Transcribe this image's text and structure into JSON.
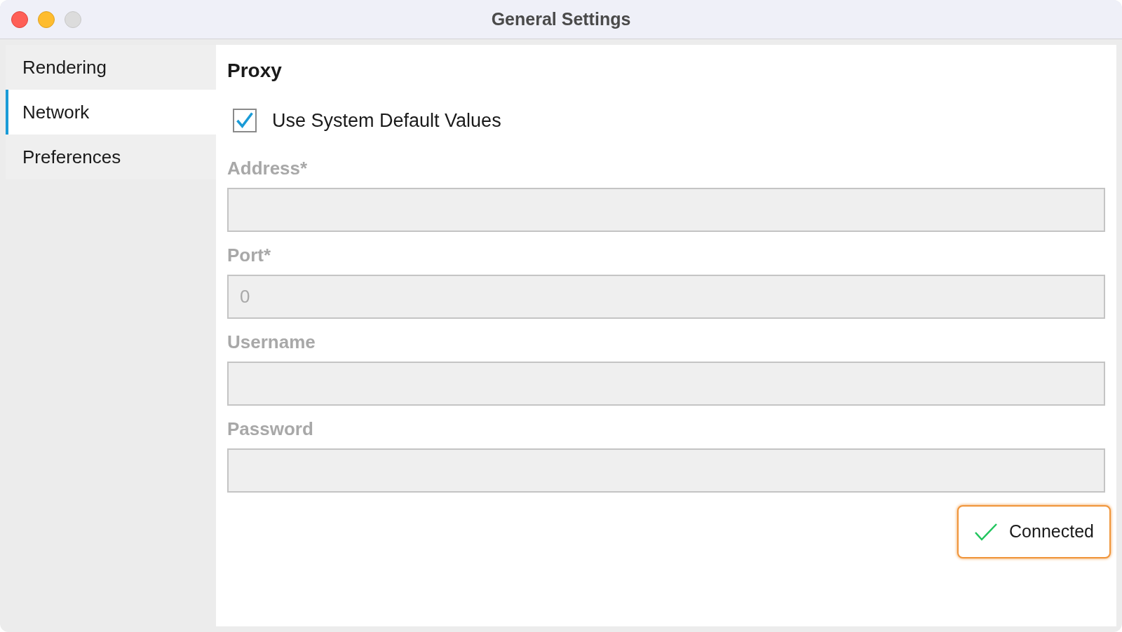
{
  "window": {
    "title": "General Settings"
  },
  "sidebar": {
    "items": [
      {
        "label": "Rendering",
        "selected": false
      },
      {
        "label": "Network",
        "selected": true
      },
      {
        "label": "Preferences",
        "selected": false
      }
    ]
  },
  "section": {
    "title": "Proxy",
    "checkbox": {
      "label": "Use System Default Values",
      "checked": true
    },
    "fields": [
      {
        "label": "Address*",
        "disabled": true
      },
      {
        "label": "Port*",
        "value": "0",
        "disabled": true
      },
      {
        "label": "Username",
        "disabled": true
      },
      {
        "label": "Password",
        "disabled": true
      }
    ],
    "status_button": {
      "label": "Connected",
      "focused": true
    }
  }
}
